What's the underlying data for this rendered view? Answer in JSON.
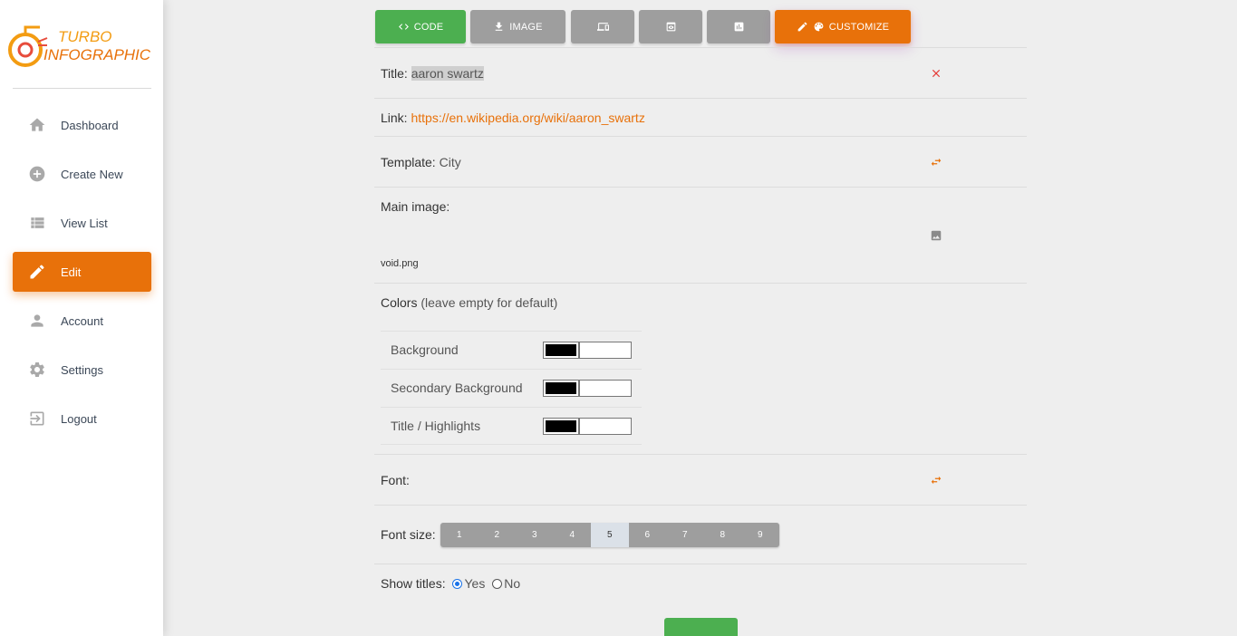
{
  "brand": {
    "line1": "TURBO",
    "line2": "INFOGRAPHIC",
    "color": "#f39c12"
  },
  "sidebar": {
    "items": [
      {
        "label": "Dashboard",
        "icon": "home-icon"
      },
      {
        "label": "Create New",
        "icon": "add-circle-icon"
      },
      {
        "label": "View List",
        "icon": "list-icon"
      },
      {
        "label": "Edit",
        "icon": "edit-icon",
        "active": true
      },
      {
        "label": "Account",
        "icon": "person-icon"
      },
      {
        "label": "Settings",
        "icon": "gear-icon"
      },
      {
        "label": "Logout",
        "icon": "logout-icon"
      }
    ]
  },
  "toolbar": {
    "code_label": "CODE",
    "image_label": "IMAGE",
    "customize_label": "CUSTOMIZE"
  },
  "form": {
    "title_label": "Title:",
    "title_value": "aaron swartz",
    "link_label": "Link:",
    "link_value": "https://en.wikipedia.org/wiki/aaron_swartz",
    "template_label": "Template:",
    "template_value": "City",
    "main_image_label": "Main image",
    "main_image_file": "void.png",
    "colors_label": "Colors",
    "colors_hint": "(leave empty for default)",
    "colors": [
      {
        "label": "Background",
        "value": ""
      },
      {
        "label": "Secondary Background",
        "value": ""
      },
      {
        "label": "Title / Highlights",
        "value": ""
      }
    ],
    "font_label": "Font:",
    "font_size_label": "Font size:",
    "font_sizes": [
      "1",
      "2",
      "3",
      "4",
      "5",
      "6",
      "7",
      "8",
      "9"
    ],
    "font_size_selected": "5",
    "show_titles_label": "Show titles:",
    "show_titles_yes": "Yes",
    "show_titles_no": "No",
    "show_titles_selected": "Yes"
  },
  "colors": {
    "accent": "#e8710a",
    "success": "#4caf50",
    "neutral_button": "#9e9e9e",
    "danger": "#e53935"
  }
}
